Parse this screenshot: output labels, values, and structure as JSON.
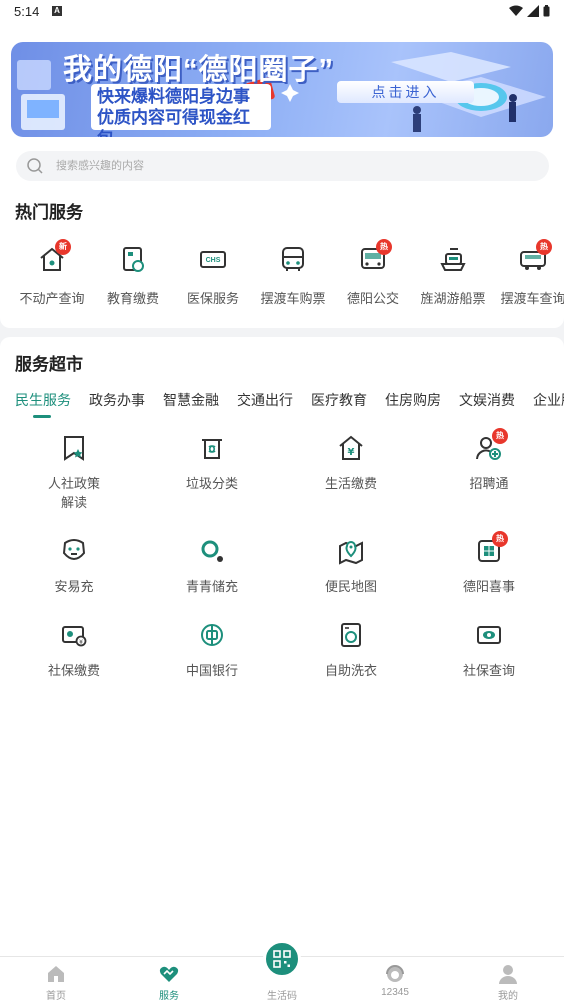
{
  "status_bar": {
    "time": "5:14",
    "notif_letter": "A"
  },
  "banner": {
    "title": "我的德阳“德阳圈子”",
    "line1": "快来爆料德阳身边事",
    "line2": "优质内容可得现金红包",
    "cta": "点击进入"
  },
  "search": {
    "placeholder": "搜索感兴趣的内容"
  },
  "hot_services": {
    "title": "热门服务",
    "items": [
      {
        "label": "不动产查询",
        "icon": "house-icon",
        "badge": "新"
      },
      {
        "label": "教育缴费",
        "icon": "school-fee-icon",
        "badge": ""
      },
      {
        "label": "医保服务",
        "icon": "medical-card-icon",
        "badge": ""
      },
      {
        "label": "摆渡车购票",
        "icon": "shuttle-bus-icon",
        "badge": ""
      },
      {
        "label": "德阳公交",
        "icon": "bus-icon",
        "badge": "热"
      },
      {
        "label": "旌湖游船票",
        "icon": "boat-icon",
        "badge": ""
      },
      {
        "label": "摆渡车查询",
        "icon": "shuttle-query-icon",
        "badge": "热"
      }
    ]
  },
  "market": {
    "title": "服务超市",
    "tabs": [
      "民生服务",
      "政务办事",
      "智慧金融",
      "交通出行",
      "医疗教育",
      "住房购房",
      "文娱消费",
      "企业服务"
    ],
    "active_tab": "民生服务",
    "items": [
      {
        "label": "人社政策\n解读",
        "line1": "人社政策",
        "line2": "解读",
        "icon": "policy-icon",
        "badge": ""
      },
      {
        "label": "垃圾分类",
        "line1": "垃圾分类",
        "line2": "",
        "icon": "trash-icon",
        "badge": ""
      },
      {
        "label": "生活缴费",
        "line1": "生活缴费",
        "line2": "",
        "icon": "payment-icon",
        "badge": ""
      },
      {
        "label": "招聘通",
        "line1": "招聘通",
        "line2": "",
        "icon": "recruit-icon",
        "badge": "热"
      },
      {
        "label": "安易充",
        "line1": "安易充",
        "line2": "",
        "icon": "charging-icon",
        "badge": ""
      },
      {
        "label": "青青储充",
        "line1": "青青储充",
        "line2": "",
        "icon": "storage-charge-icon",
        "badge": ""
      },
      {
        "label": "便民地图",
        "line1": "便民地图",
        "line2": "",
        "icon": "map-icon",
        "badge": ""
      },
      {
        "label": "德阳喜事",
        "line1": "德阳喜事",
        "line2": "",
        "icon": "celebration-icon",
        "badge": "热"
      },
      {
        "label": "社保缴费",
        "line1": "社保缴费",
        "line2": "",
        "icon": "social-pay-icon",
        "badge": ""
      },
      {
        "label": "中国银行",
        "line1": "中国银行",
        "line2": "",
        "icon": "bank-icon",
        "badge": ""
      },
      {
        "label": "自助洗衣",
        "line1": "自助洗衣",
        "line2": "",
        "icon": "laundry-icon",
        "badge": ""
      },
      {
        "label": "社保查询",
        "line1": "社保查询",
        "line2": "",
        "icon": "social-query-icon",
        "badge": ""
      }
    ]
  },
  "tabbar": {
    "items": [
      {
        "label": "首页",
        "icon": "home-icon"
      },
      {
        "label": "服务",
        "icon": "service-icon"
      },
      {
        "label": "生活码",
        "icon": "qr-code-icon"
      },
      {
        "label": "12345",
        "icon": "hotline-icon"
      },
      {
        "label": "我的",
        "icon": "profile-icon"
      }
    ],
    "active": "服务"
  },
  "colors": {
    "accent": "#1d8f7c",
    "badge": "#e8372c",
    "banner": "#7f9ff0"
  }
}
